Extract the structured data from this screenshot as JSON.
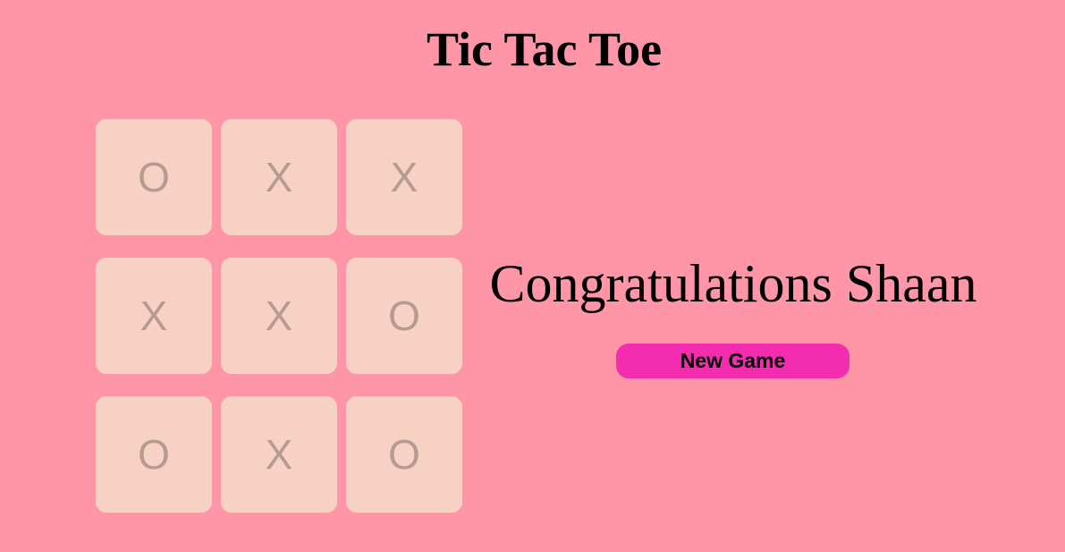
{
  "title": "Tic Tac Toe",
  "board": {
    "cells": [
      "O",
      "X",
      "X",
      "X",
      "X",
      "O",
      "O",
      "X",
      "O"
    ]
  },
  "message": "Congratulations Shaan",
  "new_game_label": "New Game",
  "colors": {
    "background": "#ff96a7",
    "cell": "#f6d1c4",
    "mark": "#b79b92",
    "button": "#f42cb0"
  }
}
